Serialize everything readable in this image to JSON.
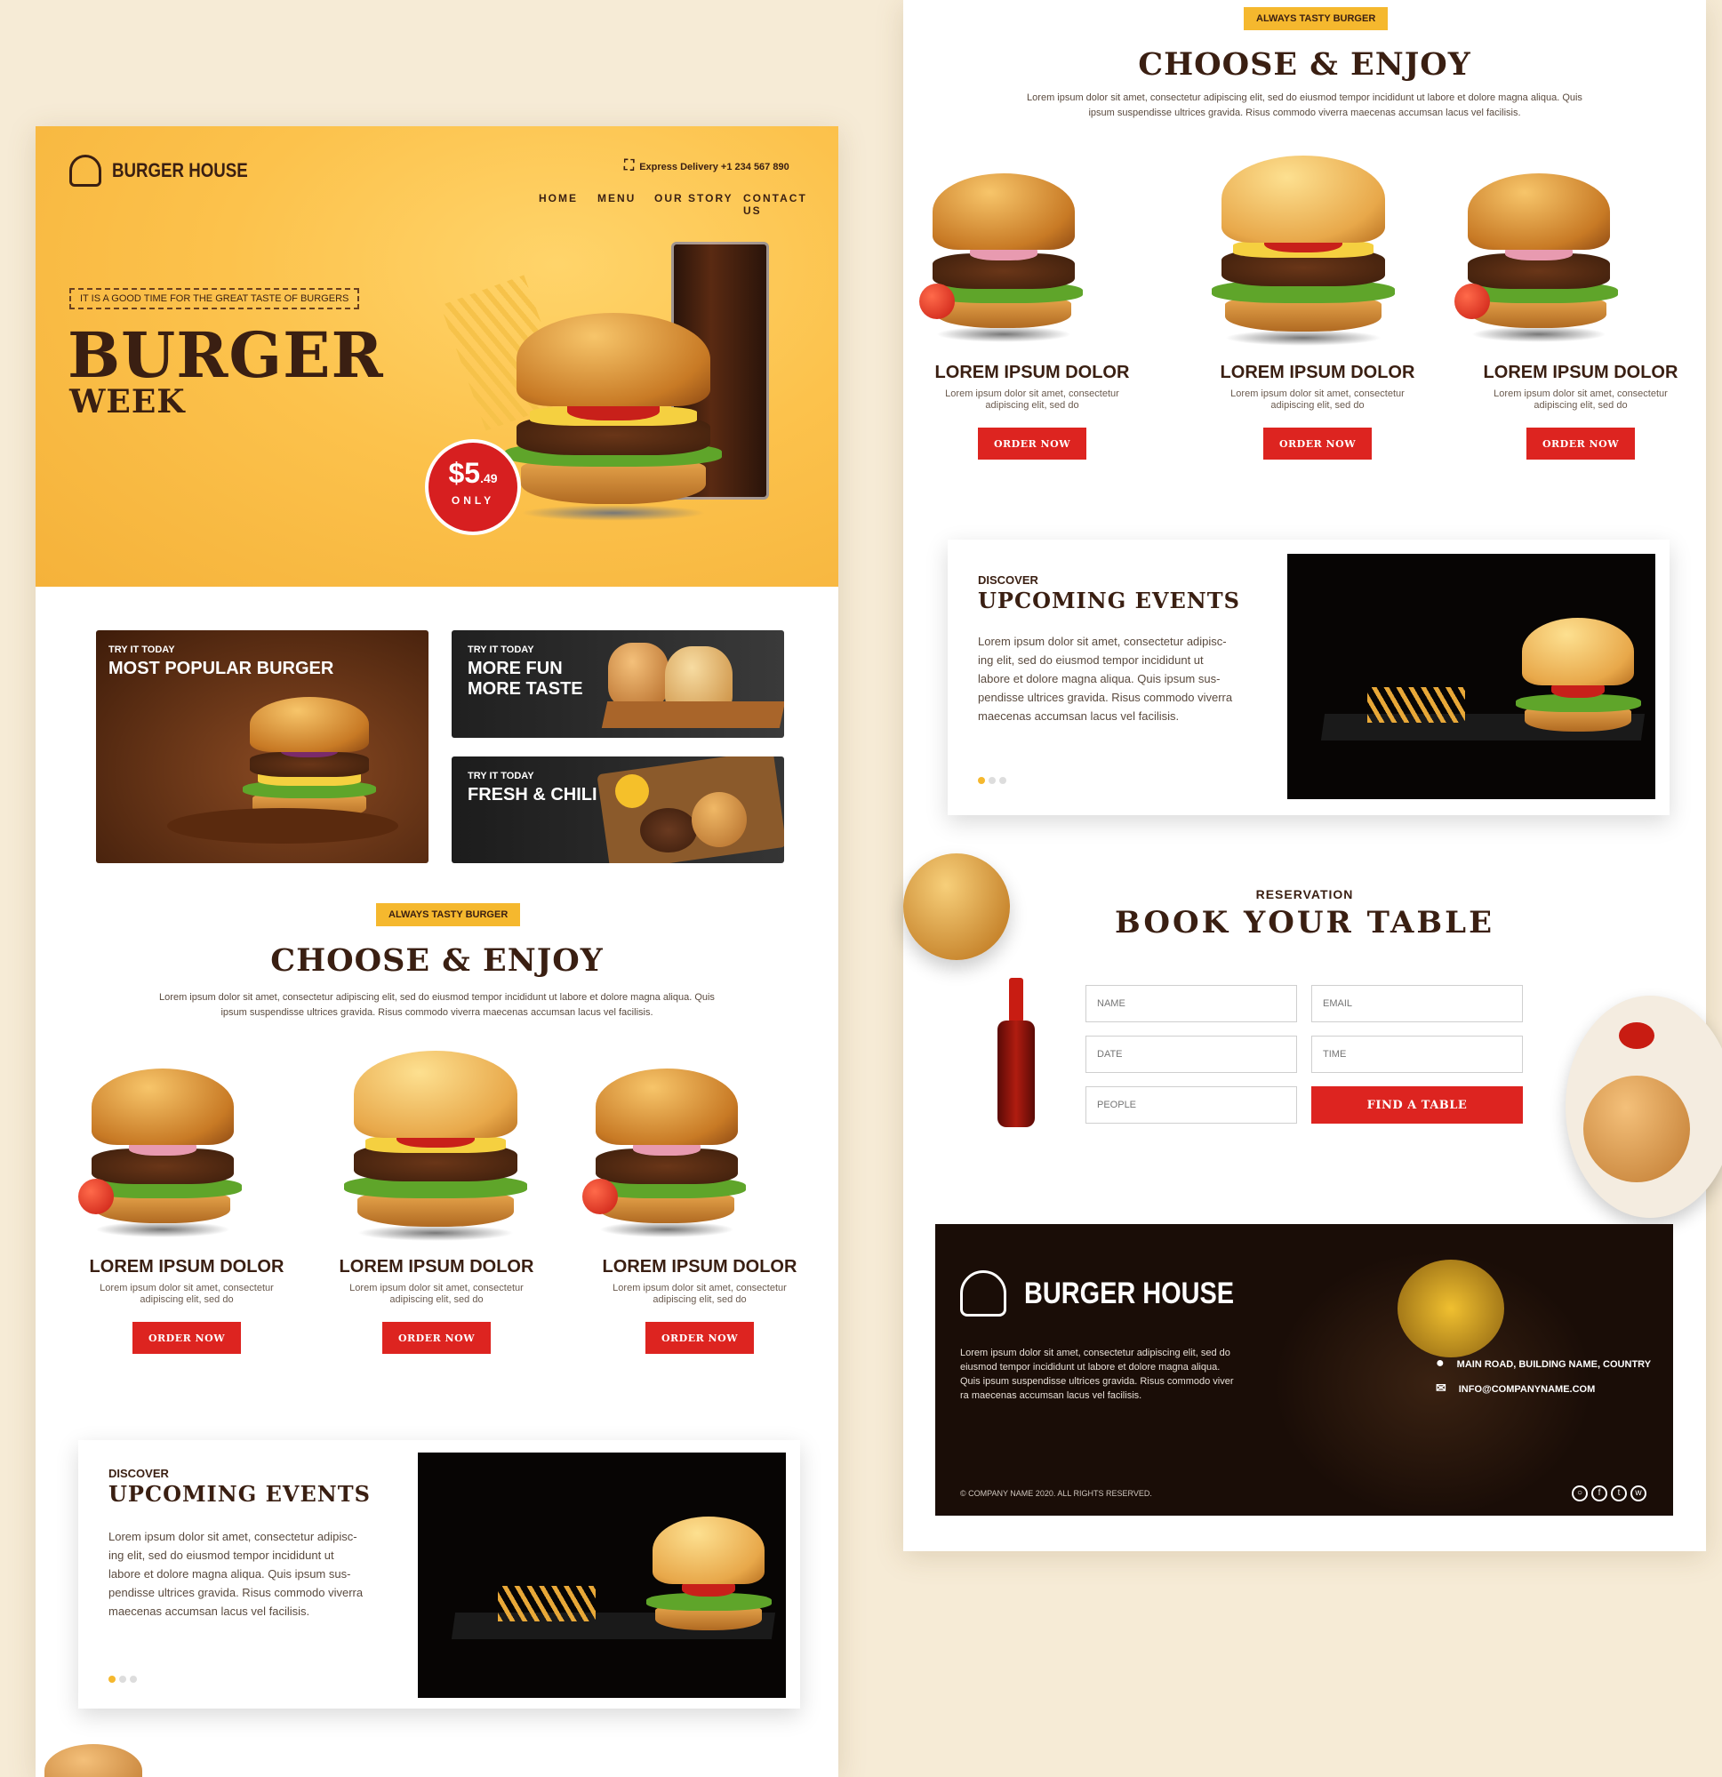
{
  "brand": {
    "name": "BURGER HOUSE"
  },
  "header": {
    "delivery": "Express Delivery +1 234 567 890",
    "nav": [
      "HOME",
      "MENU",
      "OUR STORY",
      "CONTACT US"
    ]
  },
  "hero": {
    "tagline": "IT IS A GOOD TIME FOR THE GREAT TASTE OF BURGERS",
    "title_line1": "BURGER",
    "title_line2": "WEEK",
    "price_main": "$5",
    "price_cents": ".49",
    "price_note": "ONLY"
  },
  "promos": [
    {
      "kicker": "TRY IT TODAY",
      "title": "MOST POPULAR BURGER"
    },
    {
      "kicker": "TRY IT TODAY",
      "title": "MORE FUN",
      "title2": "MORE TASTE"
    },
    {
      "kicker": "TRY IT TODAY",
      "title": "FRESH & CHILI"
    }
  ],
  "choose": {
    "chip": "ALWAYS TASTY BURGER",
    "title": "CHOOSE & ENJOY",
    "text1": "Lorem ipsum dolor sit amet, consectetur adipiscing elit, sed do eiusmod tempor incididunt ut labore et dolore magna aliqua. Quis",
    "text2": "ipsum suspendisse ultrices gravida. Risus commodo viverra maecenas accumsan lacus vel facilisis.",
    "items": [
      {
        "title": "LOREM IPSUM DOLOR",
        "desc1": "Lorem ipsum dolor sit amet, consectetur",
        "desc2": "adipiscing elit, sed do",
        "button": "ORDER NOW"
      },
      {
        "title": "LOREM IPSUM DOLOR",
        "desc1": "Lorem ipsum dolor sit amet, consectetur",
        "desc2": "adipiscing elit, sed do",
        "button": "ORDER NOW"
      },
      {
        "title": "LOREM IPSUM DOLOR",
        "desc1": "Lorem ipsum dolor sit amet, consectetur",
        "desc2": "adipiscing elit, sed do",
        "button": "ORDER NOW"
      }
    ]
  },
  "events": {
    "kicker": "DISCOVER",
    "title": "UPCOMING EVENTS",
    "lines": [
      "Lorem ipsum dolor sit amet, consectetur adipisc-",
      "ing elit, sed do eiusmod tempor incididunt ut",
      "labore et dolore magna aliqua. Quis ipsum sus-",
      "pendisse ultrices gravida. Risus commodo viverra",
      "maecenas accumsan lacus vel facilisis."
    ]
  },
  "reservation": {
    "kicker": "RESERVATION",
    "title": "BOOK YOUR TABLE",
    "fields": {
      "name": "NAME",
      "email": "EMAIL",
      "date": "DATE",
      "time": "TIME",
      "people": "PEOPLE"
    },
    "button": "FIND A TABLE"
  },
  "footer": {
    "brand": "BURGER HOUSE",
    "text1": "Lorem ipsum dolor sit amet, consectetur adipiscing elit, sed do",
    "text2": "eiusmod tempor incididunt ut labore et dolore magna aliqua.",
    "text3": "Quis ipsum suspendisse ultrices gravida. Risus commodo viver",
    "text4": "ra maecenas accumsan lacus vel facilisis.",
    "address": "MAIN ROAD, BUILDING NAME, COUNTRY",
    "email": "INFO@COMPANYNAME.COM",
    "copyright": "© COMPANY NAME 2020. ALL RIGHTS RESERVED.",
    "social_icons": [
      "instagram-icon",
      "facebook-icon",
      "twitter-icon",
      "whatsapp-icon"
    ]
  },
  "colors": {
    "accent_yellow": "#f5b82e",
    "accent_red": "#dd2420",
    "dark_brown": "#3a1f12"
  }
}
